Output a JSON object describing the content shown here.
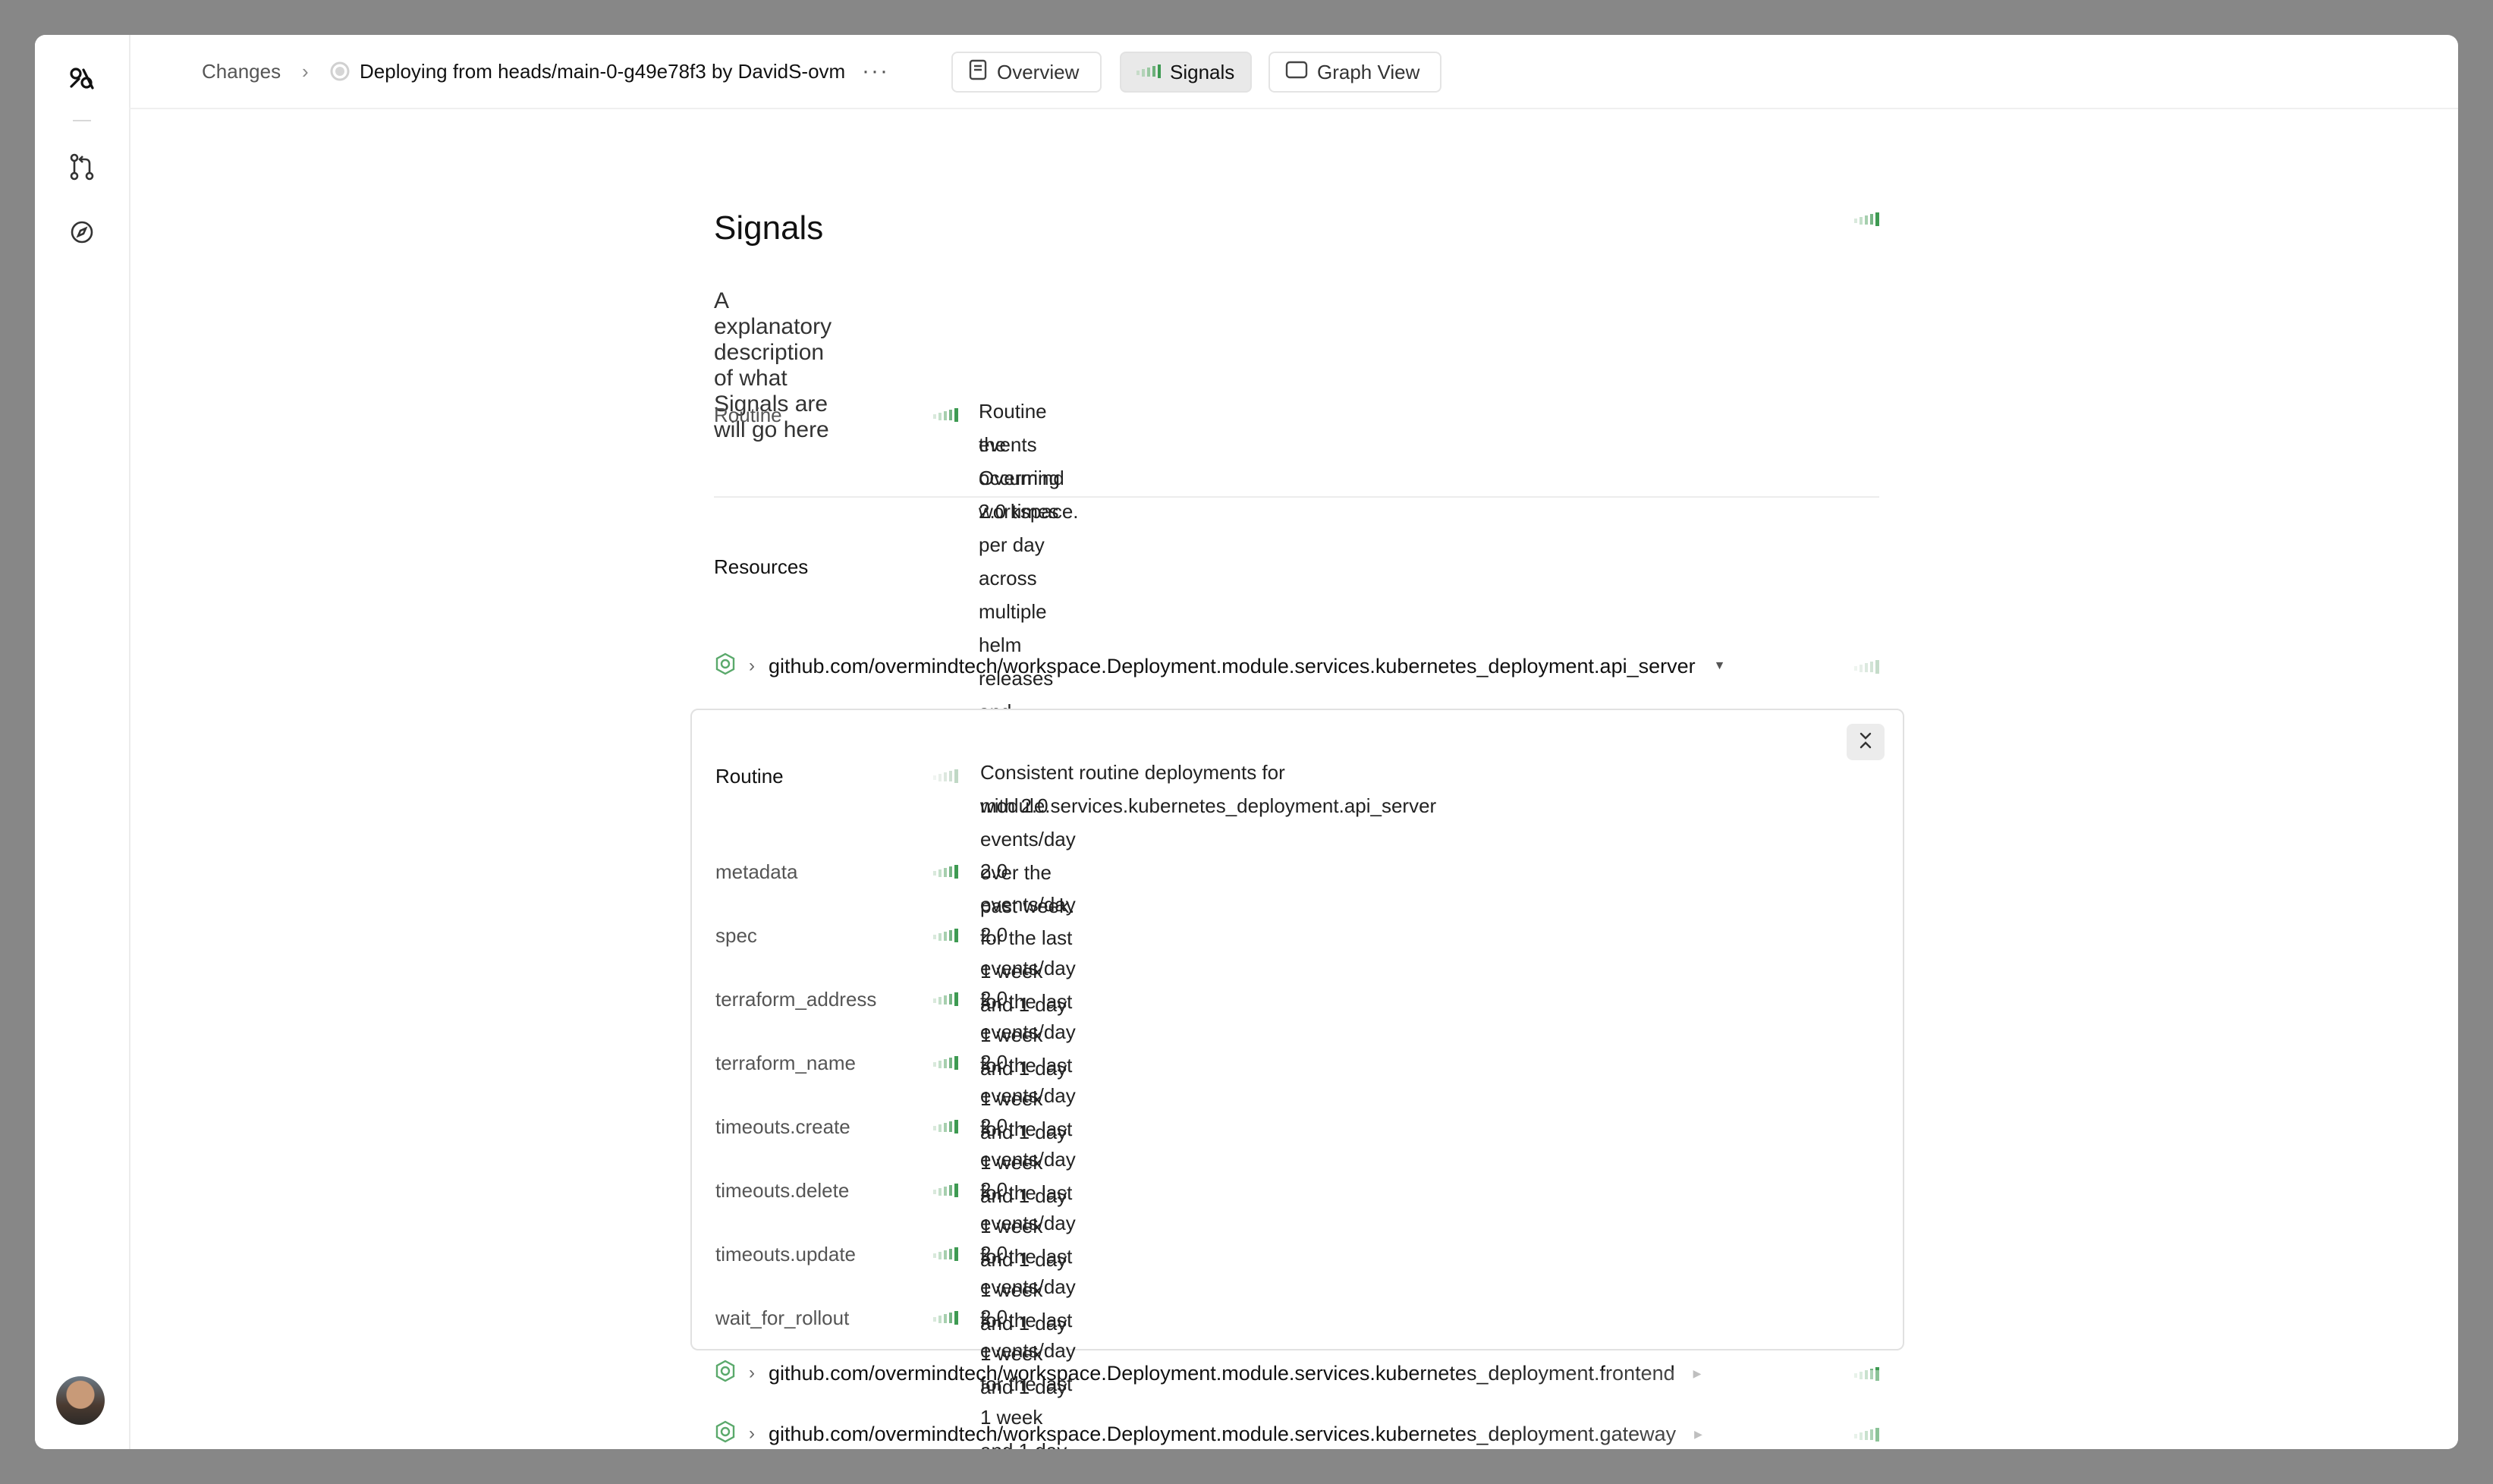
{
  "breadcrumb": {
    "changes_label": "Changes",
    "separator": "›",
    "change_title": "Deploying from heads/main-0-g49e78f3 by DavidS-ovm",
    "more_label": "···"
  },
  "tabs": [
    {
      "label": "Overview",
      "icon": "document-icon"
    },
    {
      "label": "Signals",
      "icon": "signal-bars-icon",
      "active": true
    },
    {
      "label": "Graph View",
      "icon": "window-icon"
    }
  ],
  "page": {
    "title": "Signals",
    "description": "A explanatory description of what Signals are will go here"
  },
  "summary": {
    "label": "Routine",
    "text_line1": "Routine events occurring 2.0 times per day across multiple helm releases and deployments in",
    "text_line2": "the Overmind workspace."
  },
  "resources": {
    "heading": "Resources",
    "items": [
      {
        "name": "github.com/overmindtech/workspace.Deployment.module.services.kubernetes_deployment.api_server",
        "expanded": true
      },
      {
        "name": "github.com/overmindtech/workspace.Deployment.module.services.kubernetes_deployment.frontend",
        "expanded": false
      },
      {
        "name": "github.com/overmindtech/workspace.Deployment.module.services.kubernetes_deployment.gateway",
        "expanded": false
      }
    ],
    "expanded_detail": {
      "label": "Routine",
      "text_line1": "Consistent routine deployments for module.services.kubernetes_deployment.api_server",
      "text_line2": "with 2.0 events/day over the past week.",
      "rows": [
        {
          "label": "metadata",
          "text": "2.0 events/day for the last 1 week and 1 day"
        },
        {
          "label": "spec",
          "text": "2.0 events/day for the last 1 week and 1 day"
        },
        {
          "label": "terraform_address",
          "text": "2.0 events/day for the last 1 week and 1 day"
        },
        {
          "label": "terraform_name",
          "text": "2.0 events/day for the last 1 week and 1 day"
        },
        {
          "label": "timeouts.create",
          "text": "2.0 events/day for the last 1 week and 1 day"
        },
        {
          "label": "timeouts.delete",
          "text": "2.0 events/day for the last 1 week and 1 day"
        },
        {
          "label": "timeouts.update",
          "text": "2.0 events/day for the last 1 week and 1 day"
        },
        {
          "label": "wait_for_rollout",
          "text": "2.0 events/day for the last 1 week and 1 day"
        }
      ]
    }
  },
  "colors": {
    "signal_green": "#5aa96b",
    "signal_faint": "#d6e9da",
    "background": "#878787"
  }
}
